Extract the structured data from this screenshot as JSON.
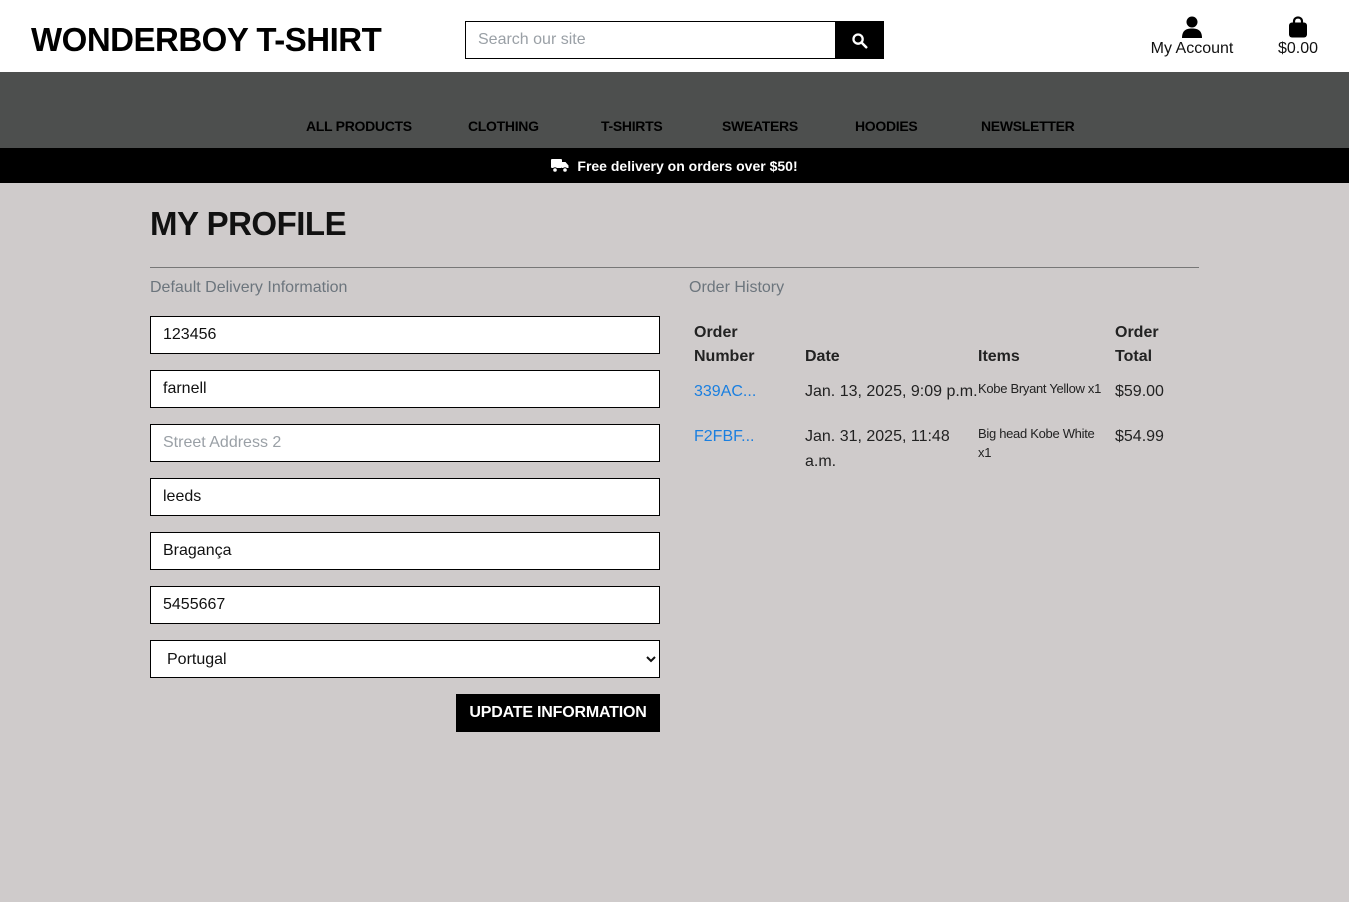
{
  "header": {
    "logo": "WONDERBOY T-SHIRT",
    "search_placeholder": "Search our site",
    "account_label": "My Account",
    "bag_total": "$0.00"
  },
  "nav": {
    "items": [
      "ALL PRODUCTS",
      "CLOTHING",
      "T-SHIRTS",
      "SWEATERS",
      "HOODIES",
      "NEWSLETTER"
    ]
  },
  "banner": {
    "text": "Free delivery on orders over $50!"
  },
  "profile": {
    "title": "MY PROFILE",
    "delivery_heading": "Default Delivery Information",
    "history_heading": "Order History",
    "fields": {
      "phone": "123456",
      "street1": "farnell",
      "street2": "",
      "street2_placeholder": "Street Address 2",
      "town": "leeds",
      "county": "Bragança",
      "postcode": "5455667",
      "country": "Portugal"
    },
    "update_label": "UPDATE INFORMATION"
  },
  "orders": {
    "headers": {
      "number_1": "Order",
      "number_2": "Number",
      "date": "Date",
      "items": "Items",
      "total_1": "Order",
      "total_2": "Total"
    },
    "rows": [
      {
        "number": "339AC...",
        "date": "Jan. 13, 2025, 9:09 p.m.",
        "items": "Kobe Bryant Yellow x1",
        "total": "$59.00"
      },
      {
        "number": "F2FBF...",
        "date_1": "Jan. 31, 2025, 11:48",
        "date_2": "a.m.",
        "items_1": "Big head Kobe White",
        "items_2": "x1",
        "total": "$54.99"
      }
    ]
  },
  "colors": {
    "page_bg": "#cfcbcb",
    "nav_bg": "#4d4f4e",
    "banner_bg": "#000000",
    "link": "#1a7fe0",
    "muted": "#6c757d"
  },
  "icons": {
    "search": "search-icon",
    "account": "user-icon",
    "bag": "shopping-bag-icon",
    "truck": "truck-icon"
  }
}
